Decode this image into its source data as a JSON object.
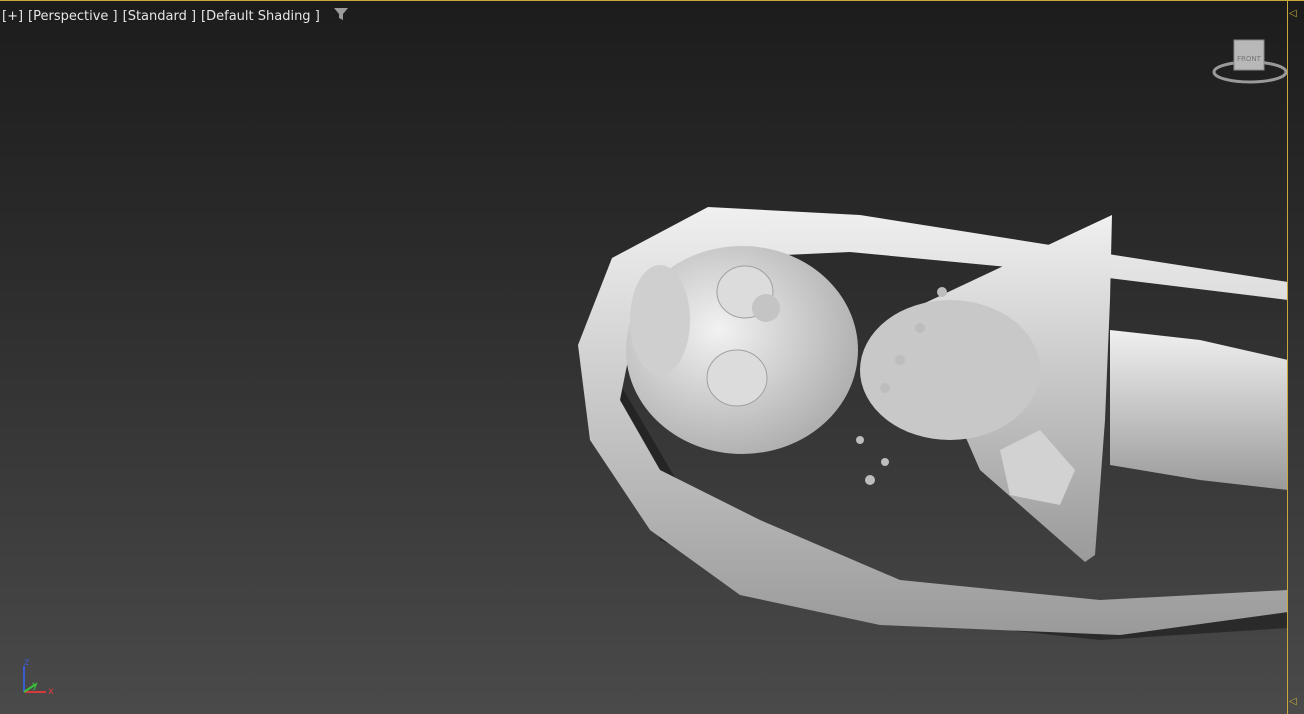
{
  "viewport": {
    "labels": {
      "plus": "[+]",
      "view": "[Perspective ]",
      "mode": "[Standard ]",
      "shading": "[Default Shading ]"
    },
    "filter_icon": "filter-icon",
    "viewcube_face": "FRONT",
    "axis": {
      "z": "z",
      "y": "y",
      "x": "x"
    }
  },
  "colors": {
    "border_accent": "#c8a93a",
    "label_text": "#e6e6e6",
    "model_color": "#d9d9d9"
  }
}
